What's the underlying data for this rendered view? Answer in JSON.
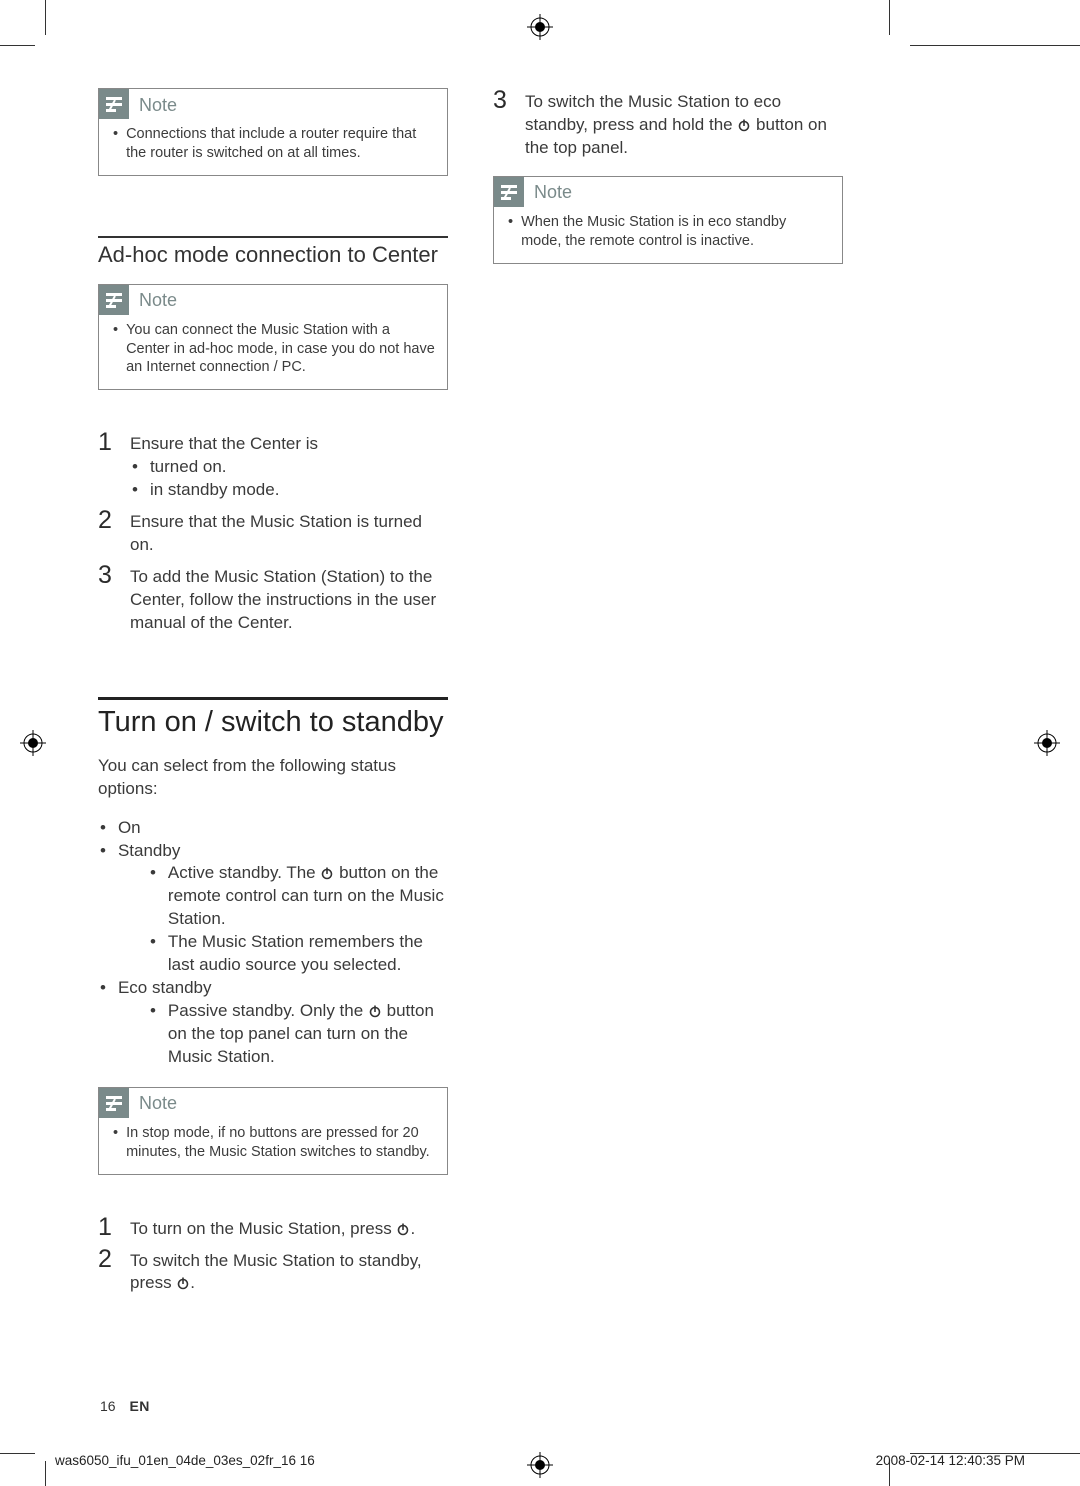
{
  "note_label": "Note",
  "left": {
    "note1": "Connections that include a router require that the router is switched on at all times.",
    "h3": "Ad-hoc mode connection to Center",
    "note2": "You can connect the Music Station with a Center in ad-hoc mode, in case you do not have an Internet connection / PC.",
    "steps1": {
      "1_lead": "Ensure that the Center is",
      "1_bullets": [
        "turned on.",
        "in standby mode."
      ],
      "2": "Ensure that the Music Station is turned on.",
      "3": "To add the Music Station (Station) to the Center, follow the instructions in the user manual of the Center."
    },
    "h2": "Turn on / switch to standby",
    "para": "You can select from the following status options:",
    "opts": {
      "on": "On",
      "standby": "Standby",
      "standby_sub": [
        {
          "pre": "Active standby. The ",
          "post": " button on the remote control can turn on the Music Station."
        },
        {
          "plain": "The Music Station remembers the last audio source you selected."
        }
      ],
      "eco": "Eco standby",
      "eco_sub": [
        {
          "pre": "Passive standby. Only the ",
          "post": " button on the top panel can turn on the Music Station."
        }
      ]
    },
    "note3": "In stop mode, if no buttons are pressed for 20 minutes, the Music Station switches to standby.",
    "steps2": {
      "1_pre": "To turn on the Music Station, press ",
      "1_post": ".",
      "2_pre": "To switch the Music Station to standby, press ",
      "2_post": "."
    }
  },
  "right": {
    "step3_pre": "To switch the Music Station to eco standby, press and hold the ",
    "step3_post": " button on the top panel.",
    "note": "When the Music Station is in eco standby mode, the remote control is inactive."
  },
  "footer": {
    "page": "16",
    "lang": "EN"
  },
  "slug": {
    "left": "was6050_ifu_01en_04de_03es_02fr_16   16",
    "right": "2008-02-14   12:40:35 PM"
  }
}
